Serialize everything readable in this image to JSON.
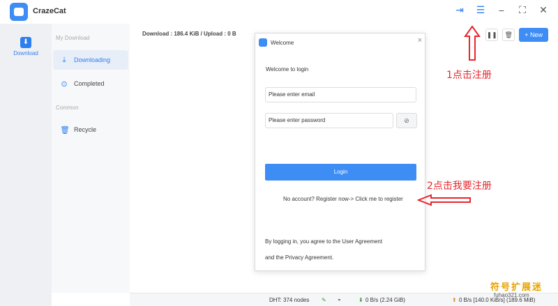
{
  "app": {
    "title": "CrazeCat"
  },
  "leftnav": {
    "download_label": "Download"
  },
  "sidebar": {
    "group_download": "My Download",
    "items": [
      {
        "label": "Downloading",
        "icon": "download-icon"
      },
      {
        "label": "Completed",
        "icon": "check-circle-icon"
      }
    ],
    "group_common": "Common",
    "recycle_label": "Recycle"
  },
  "toolbar": {
    "speed": "Download : 186.4 KiB / Upload : 0 B",
    "new_label": "+ New"
  },
  "modal": {
    "title": "Welcome",
    "welcome_text": "Welcome to login",
    "email_placeholder": "Please enter email",
    "password_placeholder": "Please enter password",
    "login_label": "Login",
    "register_text": "No account? Register now-> Click me to register",
    "agreement_line1": "By logging in, you agree to the User Agreement",
    "agreement_line2": "and the Privacy Agreement."
  },
  "status": {
    "dht": "DHT: 374 nodes",
    "down": "0 B/s (2.24 GiB)",
    "up": "0 B/s [140.0 KiB/s] (189.6 MiB)"
  },
  "annotations": {
    "step1": "1点击注册",
    "step2": "2点击我要注册",
    "color": "#e8252b"
  },
  "watermark": {
    "text": "符号扩展迷",
    "url": "fuhao321.com"
  }
}
